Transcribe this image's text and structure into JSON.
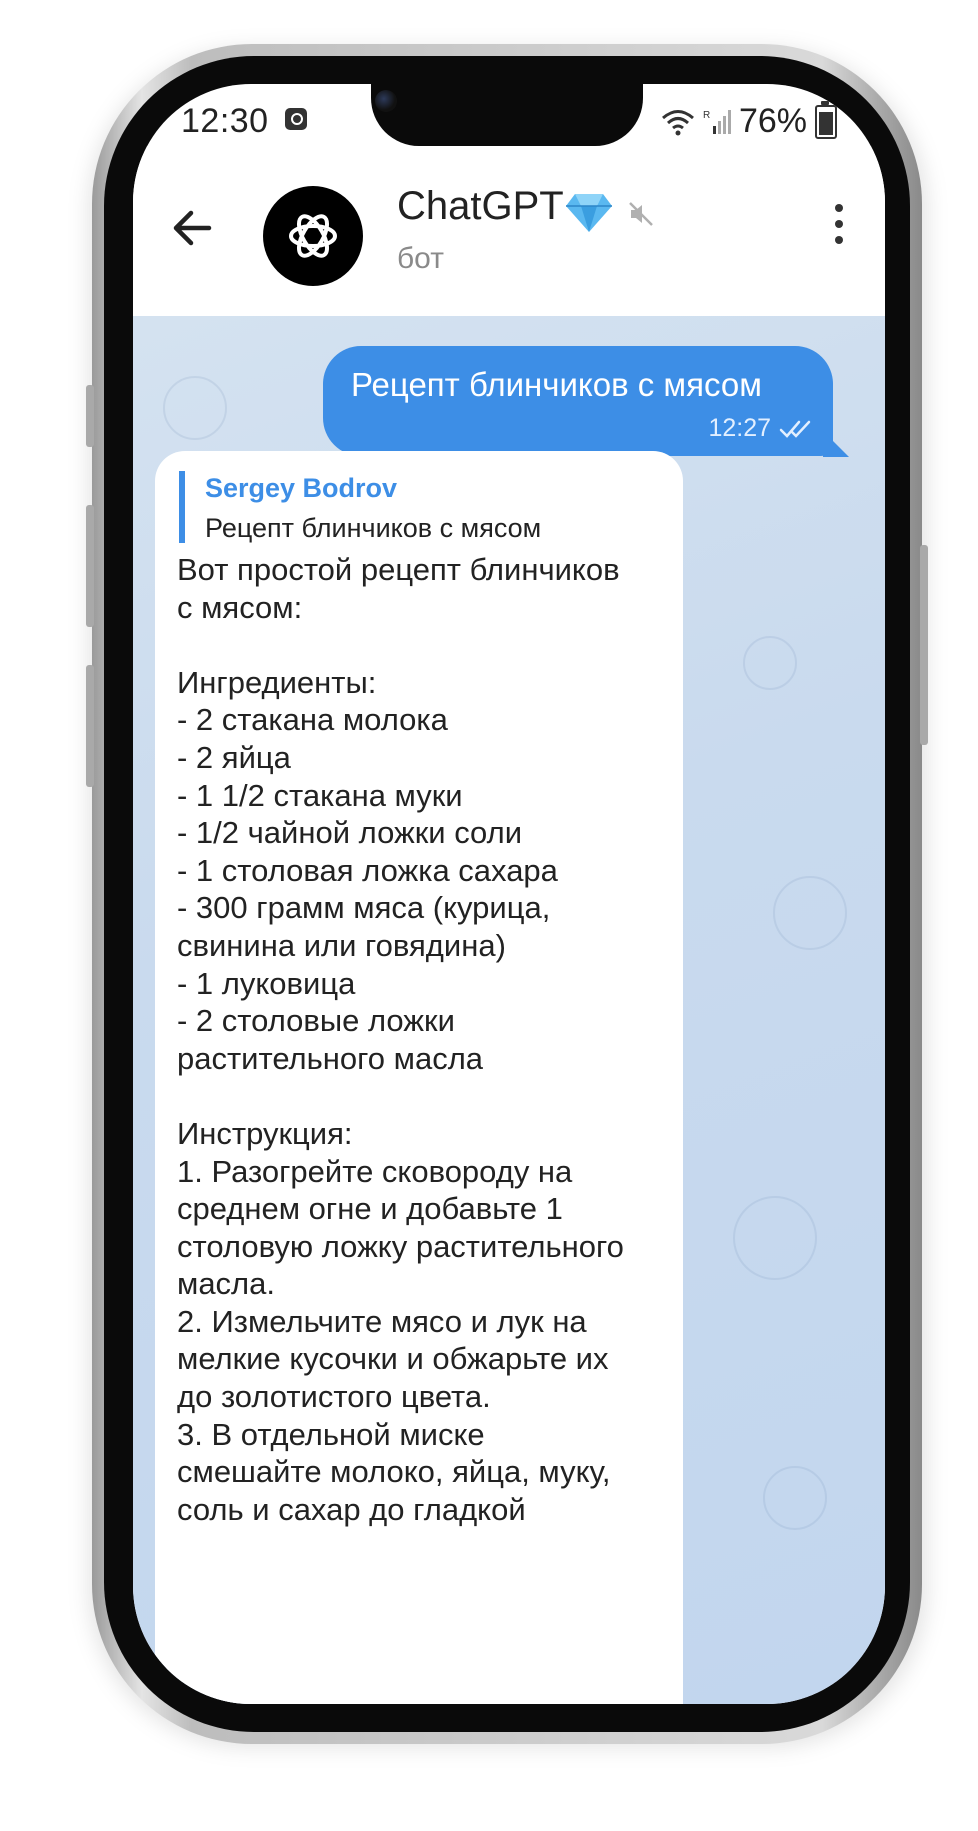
{
  "status_bar": {
    "time": "12:30",
    "battery": "76%",
    "icons": [
      "alarm-icon",
      "wifi-icon",
      "signal-icon",
      "battery-icon"
    ]
  },
  "header": {
    "title": "ChatGPT",
    "subtitle": "бот",
    "icons": [
      "back-arrow-icon",
      "openai-logo-icon",
      "premium-diamond-icon",
      "mute-icon",
      "more-vertical-icon"
    ]
  },
  "outgoing_message": {
    "text": "Рецепт блинчиков с мясом",
    "time": "12:27",
    "status_icon": "double-check-icon"
  },
  "incoming_message": {
    "reply_author": "Sergey Bodrov",
    "reply_text": "Рецепт блинчиков с мясом",
    "body": "Вот простой рецепт блинчиков\nс мясом:\n\nИнгредиенты:\n- 2 стакана молока\n- 2 яйца\n- 1 1/2 стакана муки\n- 1/2 чайной ложки соли\n- 1 столовая ложка сахара\n- 300 грамм мяса (курица,\nсвинина или говядина)\n- 1 луковица\n- 2 столовые ложки\nрастительного масла\n\nИнструкция:\n1. Разогрейте сковороду на\nсреднем огне и добавьте 1\nстоловую ложку растительного\nмасла.\n2. Измельчите мясо и лук на\nмелкие кусочки и обжарьте их\nдо золотистого цвета.\n3. В отдельной миске\nсмешайте молоко, яйца, муку,\nсоль и сахар до гладкой"
  },
  "colors": {
    "accent": "#3d8ee6",
    "chat_background": "#c9daee",
    "incoming_bubble": "#ffffff"
  }
}
